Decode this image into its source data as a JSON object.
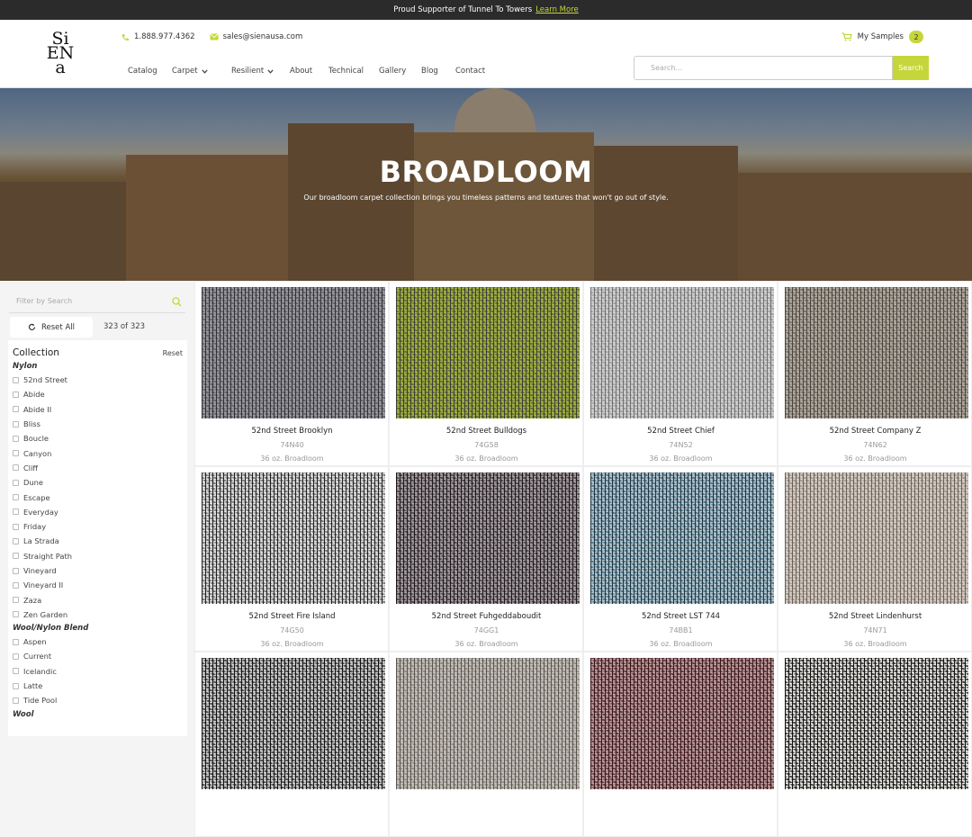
{
  "topbar": {
    "text": "Proud Supporter of Tunnel To Towers",
    "link": "Learn More"
  },
  "brand": {
    "logo_text": [
      "Si",
      "EN",
      "a"
    ]
  },
  "contact": {
    "phone": "1.888.977.4362",
    "email": "sales@sienausa.com"
  },
  "samples": {
    "label": "My Samples",
    "count": "2"
  },
  "nav": [
    {
      "label": "Catalog",
      "dropdown": false
    },
    {
      "label": "Carpet",
      "dropdown": true
    },
    {
      "label": "Resilient",
      "dropdown": true
    },
    {
      "label": "About",
      "dropdown": false
    },
    {
      "label": "Technical",
      "dropdown": false
    },
    {
      "label": "Gallery",
      "dropdown": false
    },
    {
      "label": "Blog",
      "dropdown": false
    },
    {
      "label": "Contact",
      "dropdown": false
    }
  ],
  "search": {
    "placeholder": "Search...",
    "button": "Search"
  },
  "hero": {
    "title": "BROADLOOM",
    "subtitle": "Our broadloom carpet collection brings you timeless patterns and textures that won't go out of style."
  },
  "filters": {
    "search_placeholder": "Filter by Search",
    "reset_all": "Reset All",
    "count": "323 of 323",
    "collection_title": "Collection",
    "collection_reset": "Reset",
    "groups": [
      {
        "label": "Nylon",
        "options": [
          "52nd Street",
          "Abide",
          "Abide II",
          "Bliss",
          "Boucle",
          "Canyon",
          "Cliff",
          "Dune",
          "Escape",
          "Everyday",
          "Friday",
          "La Strada",
          "Straight Path",
          "Vineyard",
          "Vineyard II",
          "Zaza",
          "Zen Garden"
        ]
      },
      {
        "label": "Wool/Nylon Blend",
        "options": [
          "Aspen",
          "Current",
          "Icelandic",
          "Latte",
          "Tide Pool"
        ]
      },
      {
        "label": "Wool",
        "options": []
      }
    ]
  },
  "colors": {
    "accent": "#c6d63a",
    "topbar": "#2b2b2b"
  },
  "products": [
    {
      "name": "52nd Street Brooklyn",
      "code": "74N40",
      "spec": "36 oz. Broadloom",
      "swatch": [
        "#5a5a60",
        "#9a9aa0",
        "#2f2f36"
      ]
    },
    {
      "name": "52nd Street Bulldogs",
      "code": "74G58",
      "spec": "36 oz. Broadloom",
      "swatch": [
        "#5b6040",
        "#a4b33a",
        "#3a3d36"
      ]
    },
    {
      "name": "52nd Street Chief",
      "code": "74N52",
      "spec": "36 oz. Broadloom",
      "swatch": [
        "#9a9a9a",
        "#d2d2d2",
        "#6e6e6e"
      ]
    },
    {
      "name": "52nd Street Company Z",
      "code": "74N62",
      "spec": "36 oz. Broadloom",
      "swatch": [
        "#6e665c",
        "#b2aca2",
        "#4a443e"
      ]
    },
    {
      "name": "52nd Street Fire Island",
      "code": "74G50",
      "spec": "36 oz. Broadloom",
      "swatch": [
        "#6a6a6a",
        "#e0e0e0",
        "#1f1f1f"
      ]
    },
    {
      "name": "52nd Street Fuhgeddaboudit",
      "code": "74GG1",
      "spec": "36 oz. Broadloom",
      "swatch": [
        "#3e3a42",
        "#a89ea0",
        "#1b181d"
      ]
    },
    {
      "name": "52nd Street LST 744",
      "code": "74BB1",
      "spec": "36 oz. Broadloom",
      "swatch": [
        "#3d6a82",
        "#b8c6cc",
        "#1d3440"
      ]
    },
    {
      "name": "52nd Street Lindenhurst",
      "code": "74N71",
      "spec": "36 oz. Broadloom",
      "swatch": [
        "#9a8f86",
        "#d6cfc6",
        "#6a5f56"
      ]
    },
    {
      "name": "",
      "code": "",
      "spec": "",
      "swatch": [
        "#3a3a3a",
        "#d0d0d0",
        "#111111"
      ]
    },
    {
      "name": "",
      "code": "",
      "spec": "",
      "swatch": [
        "#8a8480",
        "#c8c2bc",
        "#5a544e"
      ]
    },
    {
      "name": "",
      "code": "",
      "spec": "",
      "swatch": [
        "#5a2a30",
        "#b8a0a0",
        "#3a1418"
      ]
    },
    {
      "name": "",
      "code": "",
      "spec": "",
      "swatch": [
        "#2a2a2a",
        "#e8e6e2",
        "#111111"
      ]
    }
  ]
}
